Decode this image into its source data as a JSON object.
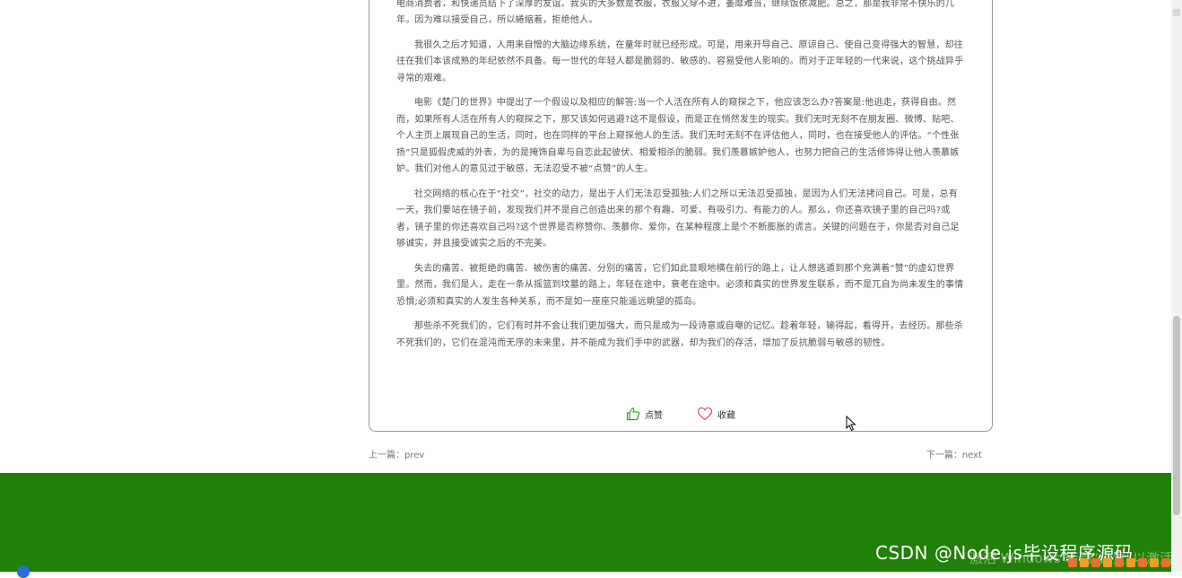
{
  "article": {
    "paragraphs": [
      "侯蹒跚的方，再加上完得自己臃臃娇者，不忍见人，使恋厚于很多体。另之，她则的全连社我都于大量们网买，也就了全国第份双度上的电商消费者，和快递员结下了深厚的友谊。我买的大多数是衣服，衣服又穿不进，萎靡难当，继续饭依减肥。总之，那是我非常不快乐的几年。因为难以接受自己，所以蜷缩着，拒绝他人。",
      "我很久之后才知道，人用来自憎的大脑边缘系统，在童年时就已经形成。可是，用来开导自己、原谅自己、使自己变得强大的智慧，却往往在我们本该成熟的年纪依然不具备。每一世代的年轻人都是脆弱的、敏感的、容易受他人影响的。而对于正年轻的一代来说，这个挑战异乎寻常的艰难。",
      "电影《楚门的世界》中提出了一个假设以及相应的解答:当一个人活在所有人的窥探之下，他应该怎么办?答案是:他逃走，获得自由。然而，如果所有人活在所有人的窥探之下，那又该如何逃避?这不是假设，而是正在悄然发生的现实。我们无时无刻不在朋友圈、微博、贴吧、个人主页上展现自己的生活，同时，也在同样的平台上窥探他人的生活。我们无时无刻不在评估他人，同时，也在接受他人的评估。“个性张扬”只是狐假虎威的外表，为的是掩饰自卑与自恋此起彼伏、相爱相杀的脆弱。我们羡慕嫉妒他人，也努力把自己的生活修饰得让他人羡慕嫉妒。我们对他人的意见过于敏感，无法忍受不被“点赞”的人生。",
      "社交网络的核心在于“社交”，社交的动力，是出于人们无法忍受孤独;人们之所以无法忍受孤独，是因为人们无法拷问自己。可是，总有一天，我们要站在镜子前，发现我们并不是自己创造出来的那个有趣、可爱、有吸引力、有能力的人。那么，你还喜欢镜子里的自己吗?或者，镜子里的你还喜欢自己吗?这个世界是否称赞你、羡慕你、爱你，在某种程度上是个不断膨胀的谎言。关键的问题在于，你是否对自己足够诚实，并且接受诚实之后的不完美。",
      "失去的痛苦、被拒绝的痛苦、被伤害的痛苦、分别的痛苦，它们如此显眼地横在前行的路上，让人想逃遁到那个充满着“赞”的虚幻世界里。然而，我们是人，走在一条从摇篮到坟墓的路上，年轻在途中，衰老在途中。必须和真实的世界发生联系，而不是兀自为尚未发生的事情恐惧;必须和真实的人发生各种关系，而不是如一座座只能遥远眺望的孤岛。",
      "那些杀不死我们的，它们有时并不会让我们更加强大，而只是成为一段诗意或自嘲的记忆。趁着年轻，输得起，看得开，去经历。那些杀不死我们的，它们在混沌而无序的未来里，并不能成为我们手中的武器，却为我们的存活，增加了反抗脆弱与敏感的韧性。"
    ]
  },
  "actions": {
    "like_label": "点赞",
    "favorite_label": "收藏"
  },
  "navigation": {
    "prev_label": "上一篇：prev",
    "next_label": "下一篇：next"
  },
  "watermark": {
    "csdn_text": "CSDN @Node.js毕设程序源码",
    "activate_text": "激活 Windows 转到“设置”以激活"
  },
  "colors": {
    "footer": "#218009",
    "like_icon": "#2ca02c",
    "favorite_icon": "#e35d6a"
  }
}
